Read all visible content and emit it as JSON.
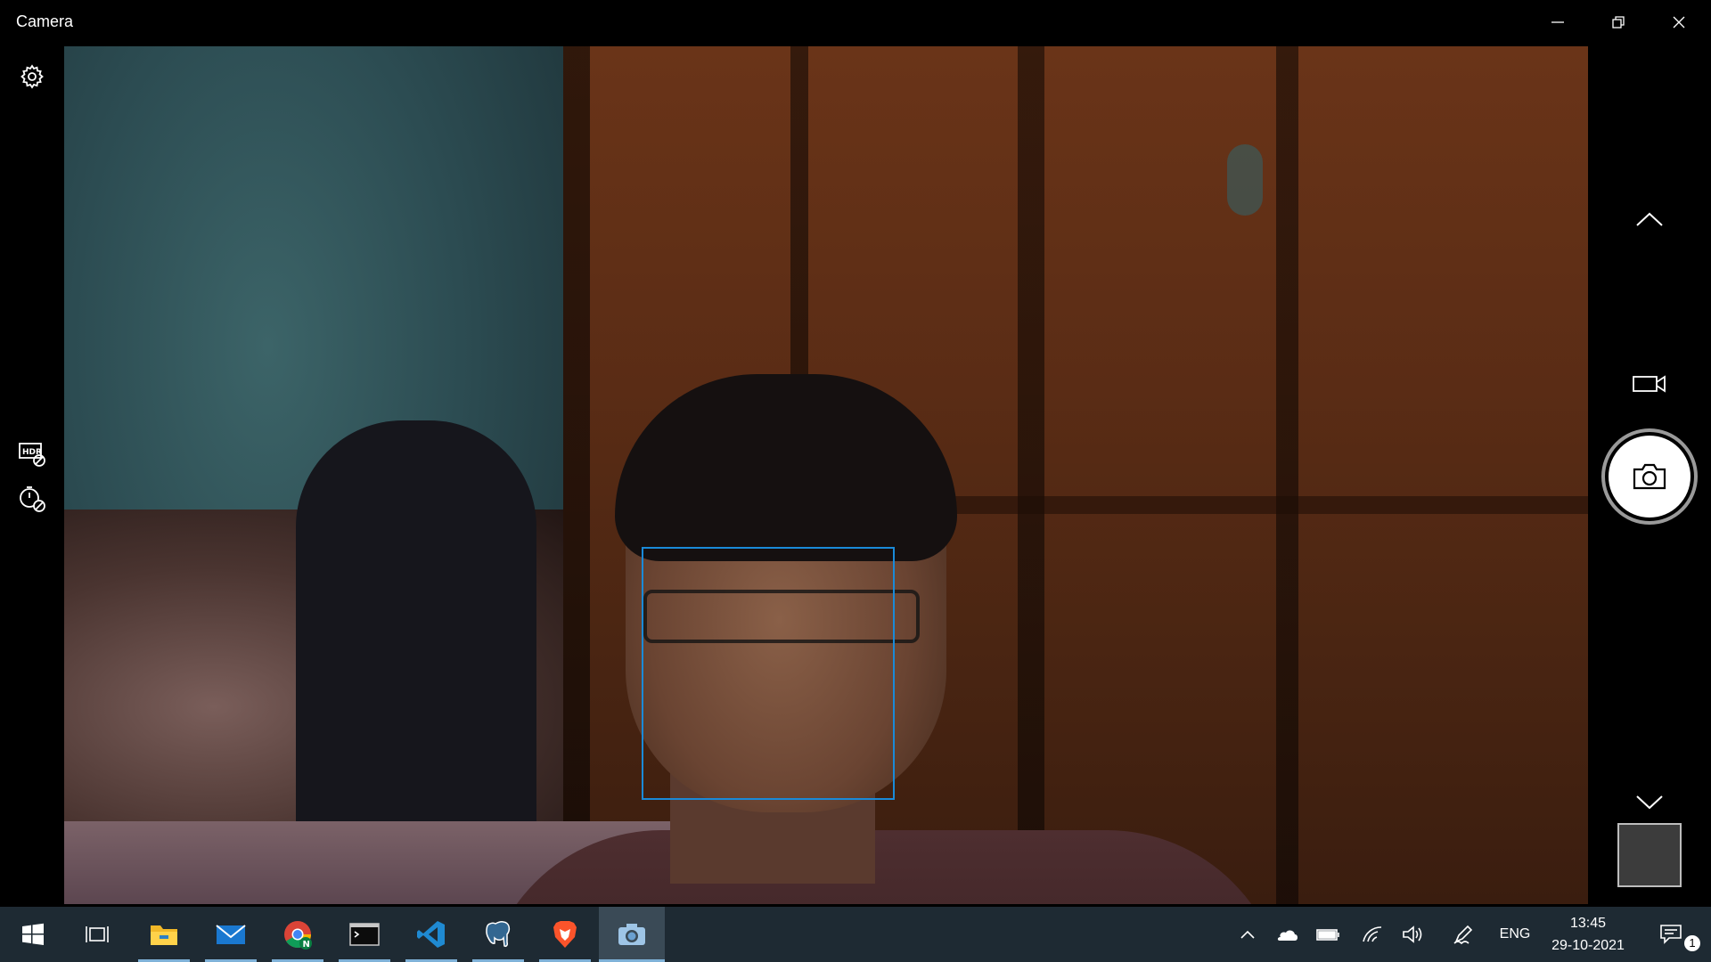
{
  "window": {
    "title": "Camera",
    "controls": [
      "minimize",
      "restore",
      "close"
    ]
  },
  "left_rail": {
    "icons": [
      "settings-icon",
      "hdr-off-icon",
      "timer-off-icon"
    ]
  },
  "viewfinder": {
    "face_detection_color": "#1a8ad8"
  },
  "right_rail": {
    "icons": [
      "chevron-up-icon",
      "video-mode-icon",
      "photo-capture-icon",
      "chevron-down-icon"
    ],
    "shutter_mode": "photo"
  },
  "taskbar": {
    "apps": [
      {
        "name": "start",
        "icon": "windows-logo-icon"
      },
      {
        "name": "task-view",
        "icon": "task-view-icon"
      },
      {
        "name": "file-explorer",
        "icon": "folder-icon",
        "running": true
      },
      {
        "name": "mail",
        "icon": "mail-icon",
        "running": true
      },
      {
        "name": "chrome",
        "icon": "chrome-icon",
        "running": true
      },
      {
        "name": "terminal",
        "icon": "terminal-icon",
        "running": true
      },
      {
        "name": "vscode",
        "icon": "vscode-icon",
        "running": true
      },
      {
        "name": "pgadmin",
        "icon": "postgres-elephant-icon",
        "running": true
      },
      {
        "name": "brave",
        "icon": "brave-lion-icon",
        "running": true
      },
      {
        "name": "camera",
        "icon": "camera-icon",
        "running": true,
        "active": true
      }
    ],
    "tray": {
      "language": "ENG",
      "time": "13:45",
      "date": "29-10-2021",
      "notification_count": "1"
    }
  }
}
